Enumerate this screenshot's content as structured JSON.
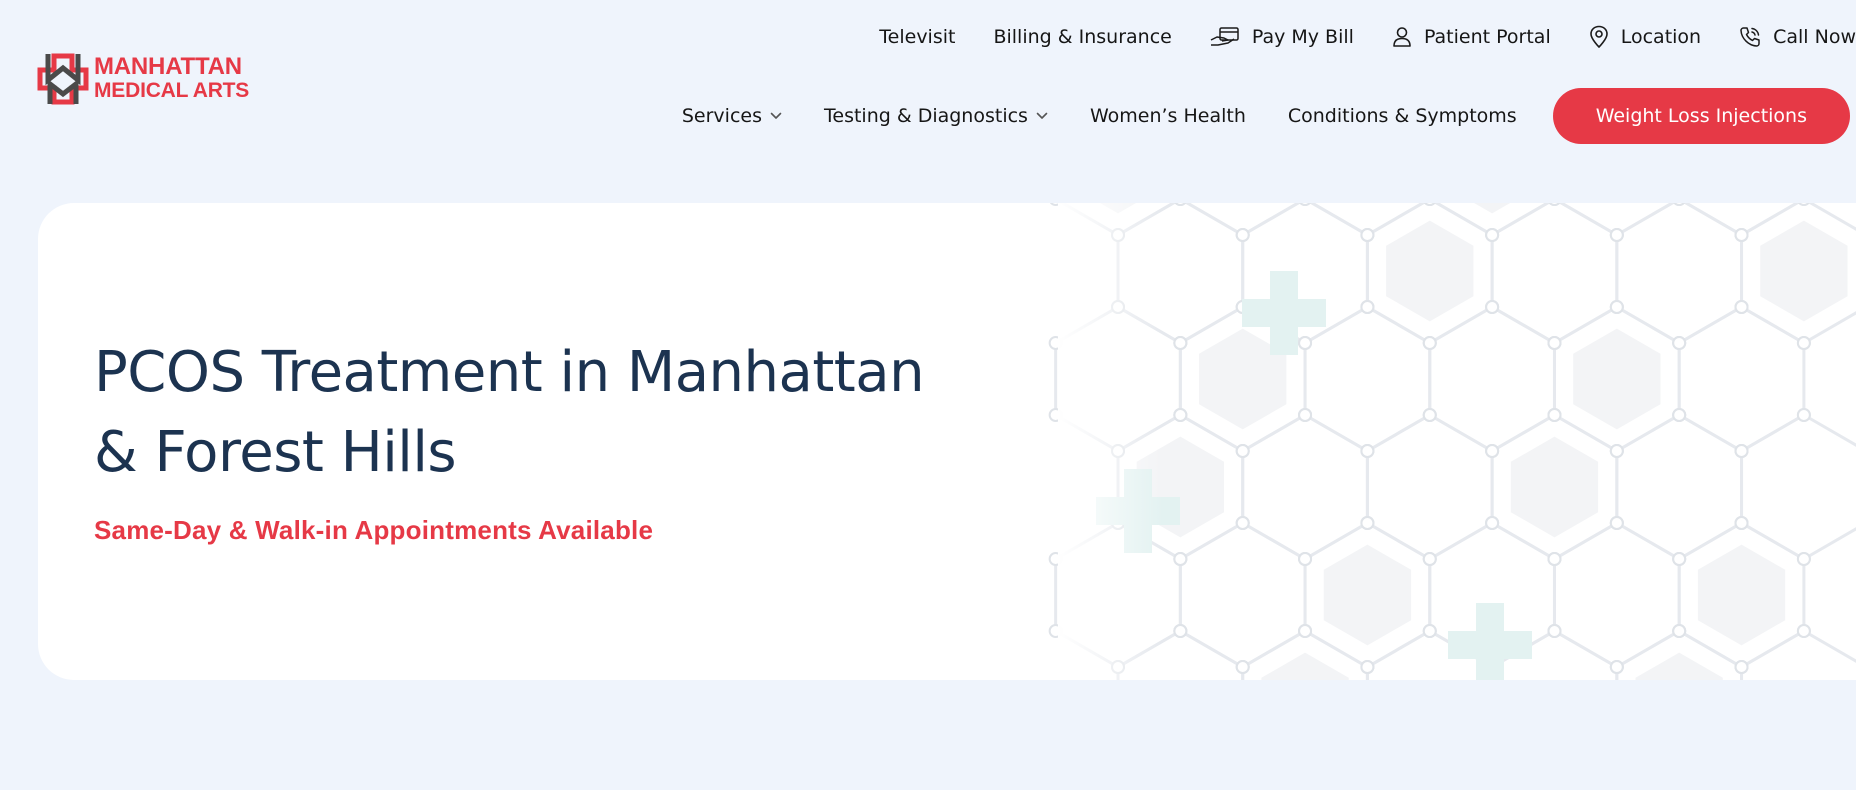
{
  "brand": {
    "name_line1": "MANHATTAN",
    "name_line2": "MEDICAL ARTS",
    "primary_color": "#e63946",
    "dark_color": "#1c3350"
  },
  "top_bar": {
    "items": [
      {
        "label": "Televisit",
        "icon": null
      },
      {
        "label": "Billing & Insurance",
        "icon": null
      },
      {
        "label": "Pay My Bill",
        "icon": "hand-card-icon"
      },
      {
        "label": "Patient Portal",
        "icon": "user-icon"
      },
      {
        "label": "Location",
        "icon": "map-pin-icon"
      },
      {
        "label": "Call Now",
        "icon": "phone-icon"
      }
    ]
  },
  "main_nav": {
    "items": [
      {
        "label": "Services",
        "dropdown": true
      },
      {
        "label": "Testing & Diagnostics",
        "dropdown": true
      },
      {
        "label": "Women’s Health",
        "dropdown": false
      },
      {
        "label": "Conditions & Symptoms",
        "dropdown": false
      }
    ],
    "cta_label": "Weight Loss Injections"
  },
  "hero": {
    "title_line1": "PCOS Treatment in Manhattan",
    "title_line2": "& Forest Hills",
    "subtitle": "Same-Day & Walk-in Appointments Available"
  }
}
